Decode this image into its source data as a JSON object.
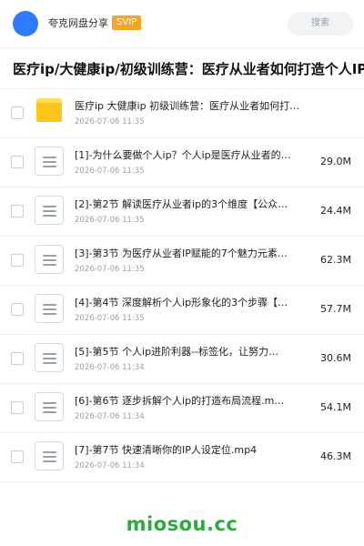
{
  "header": {
    "app_name": "夸克网盘分享",
    "badge": "SVIP",
    "search_placeholder": "搜索"
  },
  "title": "医疗ip/大健康ip/初级训练营：医疗从业者如何打造个人IP",
  "files": [
    {
      "type": "folder",
      "name": "医疗ip 大健康ip 初级训练营：医疗从业者如何打…",
      "date": "2026-07-06 11:35",
      "size": ""
    },
    {
      "type": "file",
      "name": "[1]-为什么要做个人ip？个人ip是医疗从业者的…",
      "date": "2026-07-06 11:35",
      "size": "29.0M"
    },
    {
      "type": "file",
      "name": "[2]-第2节 解读医疗从业者ip的3个维度【公众…",
      "date": "2026-07-06 11:35",
      "size": "24.4M"
    },
    {
      "type": "file",
      "name": "[3]-第3节 为医疗从业者IP赋能的7个魅力元素…",
      "date": "2026-07-06 11:35",
      "size": "62.3M"
    },
    {
      "type": "file",
      "name": "[4]-第4节 深度解析个人ip形象化的3个步骤【…",
      "date": "2026-07-06 11:35",
      "size": "57.7M"
    },
    {
      "type": "file",
      "name": "[5]-第5节 个人ip进阶利器--标签化，让努力…",
      "date": "2026-07-06 11:34",
      "size": "30.6M"
    },
    {
      "type": "file",
      "name": "[6]-第6节 逐步拆解个人ip的打造布局流程.m…",
      "date": "2026-07-06 11:34",
      "size": "54.1M"
    },
    {
      "type": "file",
      "name": "[7]-第7节 快速清晰你的IP人设定位.mp4",
      "date": "2026-07-06 11:34",
      "size": "46.3M"
    }
  ],
  "footer": {
    "brand": "miosou.cc"
  },
  "colors": {
    "avatar": "#2f7bff",
    "badge": "#f5a623",
    "folder": "#ffc61a",
    "brand": "#2eaa3c"
  }
}
